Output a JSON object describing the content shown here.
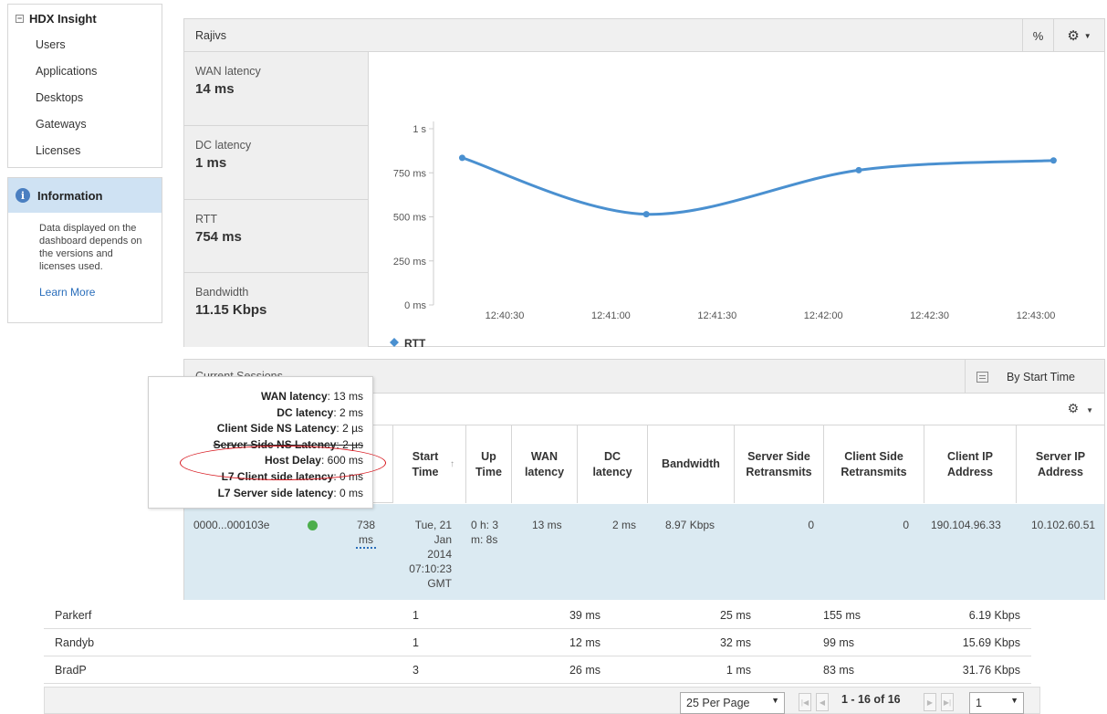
{
  "sidebar": {
    "title": "HDX Insight",
    "items": [
      "Users",
      "Applications",
      "Desktops",
      "Gateways",
      "Licenses"
    ]
  },
  "info": {
    "title": "Information",
    "text": "Data displayed on the dashboard depends on the versions and licenses used.",
    "link": "Learn More"
  },
  "panel": {
    "title": "Rajivs",
    "percent_label": "%",
    "metrics": [
      {
        "label": "WAN latency",
        "value": "14 ms"
      },
      {
        "label": "DC latency",
        "value": "1 ms"
      },
      {
        "label": "RTT",
        "value": "754 ms"
      },
      {
        "label": "Bandwidth",
        "value": "11.15 Kbps"
      }
    ]
  },
  "chart_data": {
    "type": "line",
    "title": "",
    "xlabel": "",
    "ylabel": "",
    "y_ticks": [
      "0 ms",
      "250 ms",
      "500 ms",
      "750 ms",
      "1 s"
    ],
    "x_ticks": [
      "12:40:30",
      "12:41:00",
      "12:41:30",
      "12:42:00",
      "12:42:30",
      "12:43:00"
    ],
    "ylim": [
      0,
      1000
    ],
    "series": [
      {
        "name": "RTT",
        "color": "#4a90d0",
        "points": [
          {
            "x": "12:40:18",
            "y": 835
          },
          {
            "x": "12:41:10",
            "y": 515
          },
          {
            "x": "12:42:10",
            "y": 765
          },
          {
            "x": "12:43:05",
            "y": 820
          }
        ]
      }
    ],
    "legend": "bottom-left",
    "grid": false
  },
  "sessions": {
    "title": "Current Sessions",
    "sort_label": "By Start Time",
    "columns": [
      "Start Time",
      "Up Time",
      "WAN latency",
      "DC latency",
      "Bandwidth",
      "Server Side Retransmits",
      "Client Side Retransmits",
      "Client IP Address",
      "Server IP Address"
    ],
    "row": {
      "session_id": "0000...000103e",
      "rtt_value": "738",
      "rtt_unit": "ms",
      "start_time": [
        "Tue, 21",
        "Jan",
        "2014",
        "07:10:23",
        "GMT"
      ],
      "up_time": [
        "0 h: 3",
        "m: 8s"
      ],
      "wan_latency": "13 ms",
      "dc_latency": "2 ms",
      "bandwidth": "8.97 Kbps",
      "server_retransmits": "0",
      "client_retransmits": "0",
      "client_ip": "190.104.96.33",
      "server_ip": "10.102.60.51",
      "status_color": "#4cae4c"
    }
  },
  "tooltip": {
    "lines": [
      {
        "label": "WAN latency",
        "value": "13 ms"
      },
      {
        "label": "DC latency",
        "value": "2 ms"
      },
      {
        "label": "Client Side NS Latency",
        "value": "2 µs"
      },
      {
        "label": "Server Side NS Latency",
        "value": "2 µs"
      },
      {
        "label": "Host Delay",
        "value": "600 ms"
      },
      {
        "label": "L7 Client side latency",
        "value": "0 ms"
      },
      {
        "label": "L7 Server side latency",
        "value": "0 ms"
      }
    ]
  },
  "users": [
    {
      "name": "Parkerf",
      "count": "1",
      "wan": "39 ms",
      "dc": "25 ms",
      "rtt": "155 ms",
      "bandwidth": "6.19 Kbps"
    },
    {
      "name": "Randyb",
      "count": "1",
      "wan": "12 ms",
      "dc": "32 ms",
      "rtt": "99 ms",
      "bandwidth": "15.69 Kbps"
    },
    {
      "name": "BradP",
      "count": "3",
      "wan": "26 ms",
      "dc": "1 ms",
      "rtt": "83 ms",
      "bandwidth": "31.76 Kbps"
    }
  ],
  "pagination": {
    "per_page": "25 Per Page",
    "range": "1 - 16 of 16",
    "page": "1"
  }
}
